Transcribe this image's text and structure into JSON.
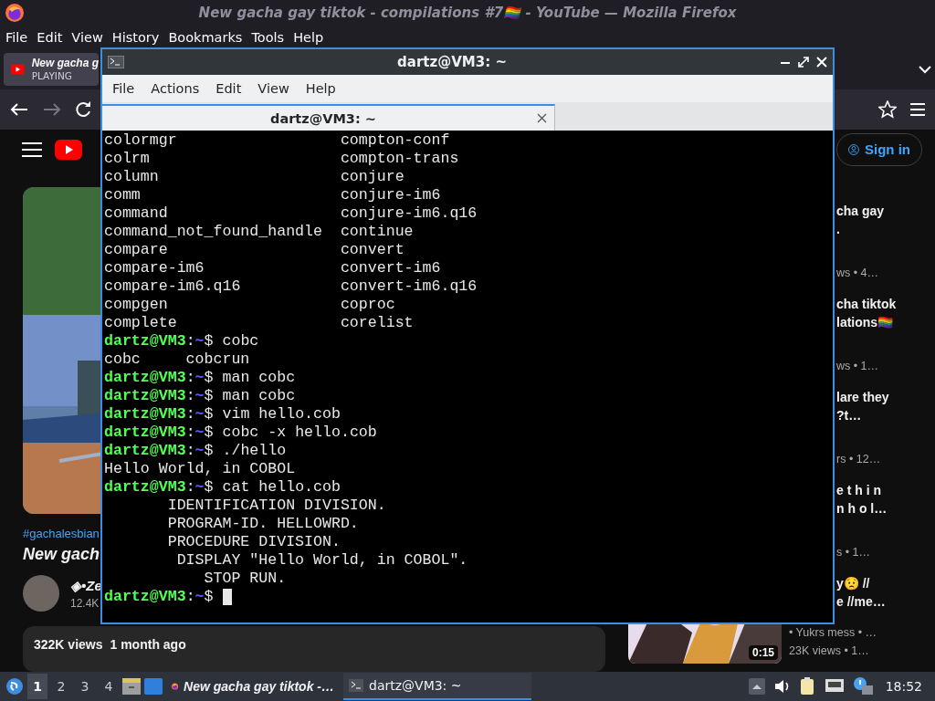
{
  "firefox": {
    "title": "New gacha gay tiktok - compilations #7🏳️‍🌈 - YouTube — Mozilla Firefox",
    "menu": [
      "File",
      "Edit",
      "View",
      "History",
      "Bookmarks",
      "Tools",
      "Help"
    ],
    "tab": {
      "title": "New gacha g",
      "status": "PLAYING"
    }
  },
  "youtube": {
    "sign_in": "Sign in",
    "hashtags": "#gachalesbian",
    "video_title": "New gach",
    "channel": "◈•Ze",
    "subscribers": "12.4K",
    "description": {
      "views": "322K views",
      "age": "1 month ago"
    },
    "recommendations": [
      {
        "title_lines": [
          "cha gay",
          "."
        ],
        "meta": "ws  • 4…"
      },
      {
        "title_lines": [
          "cha tiktok",
          "lations🏳️‍🌈"
        ],
        "meta": "ws  • 1…"
      },
      {
        "title_lines": [
          "lare they",
          "?t…"
        ],
        "meta": "rs  • 12…"
      },
      {
        "title_lines": [
          "e t h i n",
          "n h o l…"
        ],
        "meta": "s  • 1…"
      },
      {
        "title_lines": [
          "y😟 //",
          "e //me…"
        ],
        "channel": "• Yukrs mess • …",
        "meta": "23K views  • 1…",
        "duration": "0:15"
      }
    ]
  },
  "terminal": {
    "title": "dartz@VM3: ~",
    "menu": [
      "File",
      "Actions",
      "Edit",
      "View",
      "Help"
    ],
    "tab": "dartz@VM3: ~",
    "lines": [
      {
        "kind": "columns",
        "cells": [
          "colormgr",
          "compton-conf"
        ]
      },
      {
        "kind": "columns",
        "cells": [
          "colrm",
          "compton-trans"
        ]
      },
      {
        "kind": "columns",
        "cells": [
          "column",
          "conjure"
        ]
      },
      {
        "kind": "columns",
        "cells": [
          "comm",
          "conjure-im6"
        ]
      },
      {
        "kind": "columns",
        "cells": [
          "command",
          "conjure-im6.q16"
        ]
      },
      {
        "kind": "columns",
        "cells": [
          "command_not_found_handle",
          "continue"
        ]
      },
      {
        "kind": "columns",
        "cells": [
          "compare",
          "convert"
        ]
      },
      {
        "kind": "columns",
        "cells": [
          "compare-im6",
          "convert-im6"
        ]
      },
      {
        "kind": "columns",
        "cells": [
          "compare-im6.q16",
          "convert-im6.q16"
        ]
      },
      {
        "kind": "columns",
        "cells": [
          "compgen",
          "coproc"
        ]
      },
      {
        "kind": "columns",
        "cells": [
          "complete",
          "corelist"
        ]
      },
      {
        "kind": "prompt",
        "user": "dartz@VM3",
        "colon": ":",
        "path": "~",
        "sign": "$",
        "command": "cobc"
      },
      {
        "kind": "columns",
        "cells": [
          "cobc",
          "cobcrun"
        ]
      },
      {
        "kind": "prompt",
        "user": "dartz@VM3",
        "colon": ":",
        "path": "~",
        "sign": "$",
        "command": "man cobc"
      },
      {
        "kind": "prompt",
        "user": "dartz@VM3",
        "colon": ":",
        "path": "~",
        "sign": "$",
        "command": "man cobc"
      },
      {
        "kind": "prompt",
        "user": "dartz@VM3",
        "colon": ":",
        "path": "~",
        "sign": "$",
        "command": "vim hello.cob"
      },
      {
        "kind": "prompt",
        "user": "dartz@VM3",
        "colon": ":",
        "path": "~",
        "sign": "$",
        "command": "cobc -x hello.cob"
      },
      {
        "kind": "prompt",
        "user": "dartz@VM3",
        "colon": ":",
        "path": "~",
        "sign": "$",
        "command": "./hello"
      },
      {
        "kind": "output",
        "text": "Hello World, in COBOL"
      },
      {
        "kind": "prompt",
        "user": "dartz@VM3",
        "colon": ":",
        "path": "~",
        "sign": "$",
        "command": "cat hello.cob"
      },
      {
        "kind": "output",
        "text": "       IDENTIFICATION DIVISION."
      },
      {
        "kind": "output",
        "text": "       PROGRAM-ID. HELLOWRD."
      },
      {
        "kind": "output",
        "text": "       PROCEDURE DIVISION."
      },
      {
        "kind": "output",
        "text": "        DISPLAY \"Hello World, in COBOL\"."
      },
      {
        "kind": "output",
        "text": "           STOP RUN."
      },
      {
        "kind": "prompt",
        "user": "dartz@VM3",
        "colon": ":",
        "path": "~",
        "sign": "$",
        "cursor": true
      }
    ]
  },
  "taskbar": {
    "workspaces": [
      {
        "label": "1",
        "selected": true
      },
      {
        "label": "2",
        "selected": false
      },
      {
        "label": "3",
        "selected": false
      },
      {
        "label": "4",
        "selected": false
      }
    ],
    "tasks": [
      {
        "kind": "browser",
        "title": "New gacha gay tiktok -…",
        "selected": false
      },
      {
        "kind": "terminal",
        "title": "dartz@VM3: ~",
        "selected": true
      }
    ],
    "clock": "18:52"
  }
}
